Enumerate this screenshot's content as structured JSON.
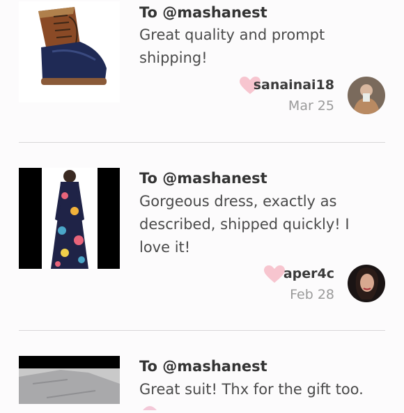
{
  "reviews": [
    {
      "to": "To @mashanest",
      "comment": "Great quality and prompt shipping!",
      "user": "sanainai18",
      "date": "Mar 25",
      "product_image": "duck-boot-image",
      "avatar": "user-avatar-sanainai18"
    },
    {
      "to": "To @mashanest",
      "comment": "Gorgeous dress, exactly as described, shipped quickly! I love it!",
      "user": "aper4c",
      "date": "Feb 28",
      "product_image": "floral-maxi-dress-image",
      "avatar": "user-avatar-aper4c"
    },
    {
      "to": "To @mashanest",
      "comment": "Great suit! Thx for the gift too.",
      "user": "",
      "date": "",
      "product_image": "gray-suit-image",
      "avatar": ""
    }
  ],
  "colors": {
    "heart": "#f7c5cf",
    "divider": "#d8d6d8",
    "date_text": "#9a9a9a"
  }
}
